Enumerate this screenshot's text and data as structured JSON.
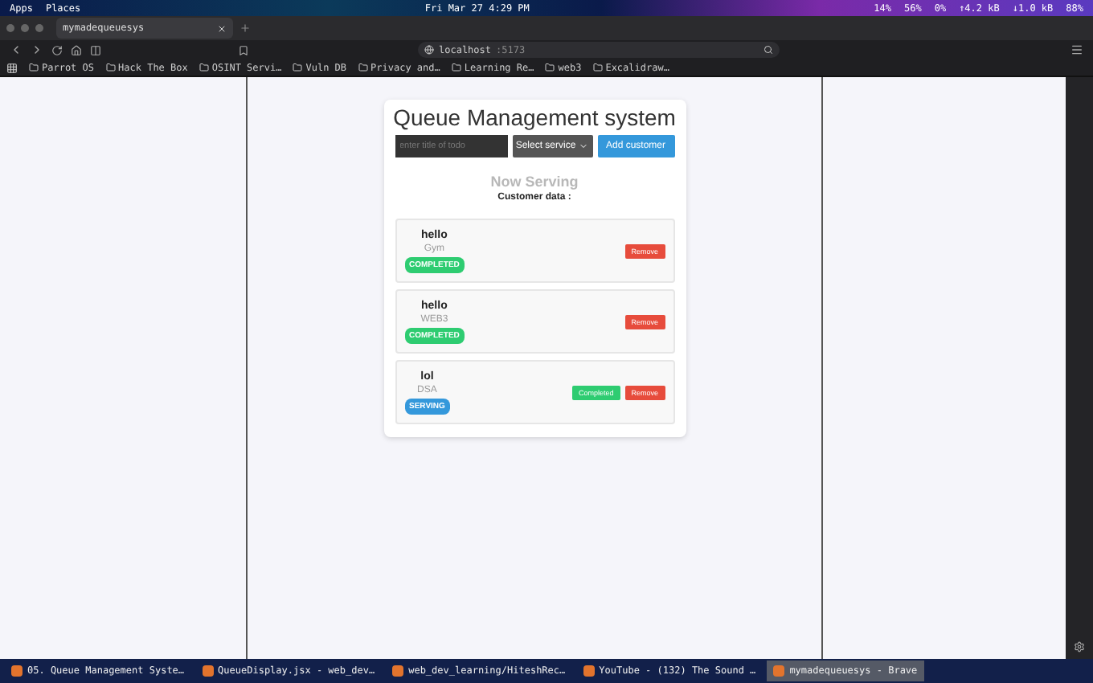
{
  "system_bar": {
    "menus": [
      "Apps",
      "Places"
    ],
    "clock": "Fri Mar 27  4:29 PM",
    "stats": [
      "14%",
      "56%",
      "0%",
      "↑4.2 kB",
      "↓1.0 kB",
      "88%"
    ]
  },
  "browser": {
    "tab_title": "mymadequeuesys",
    "address": "localhost",
    "port": ":5173",
    "bookmarks": [
      "Parrot OS",
      "Hack The Box",
      "OSINT Servi…",
      "Vuln DB",
      "Privacy and…",
      "Learning Re…",
      "web3",
      "Excalidraw…"
    ]
  },
  "app": {
    "title": "Queue Management system",
    "input": {
      "placeholder": "enter title of todo"
    },
    "select": "Select service",
    "add_button": "Add customer",
    "now_serving": "Now Serving",
    "section_label": "Customer data :",
    "customers": [
      {
        "name": "hello",
        "service": "Gym",
        "status": {
          "label": "COMPLETED",
          "kind": "completed"
        },
        "buttons": [
          {
            "label": "Remove",
            "kind": "remove"
          }
        ]
      },
      {
        "name": "hello",
        "service": "WEB3",
        "status": {
          "label": "COMPLETED",
          "kind": "completed"
        },
        "buttons": [
          {
            "label": "Remove",
            "kind": "remove"
          }
        ]
      },
      {
        "name": "lol",
        "service": "DSA",
        "status": {
          "label": "SERVING",
          "kind": "serving"
        },
        "buttons": [
          {
            "label": "Completed",
            "kind": "complete"
          },
          {
            "label": "Remove",
            "kind": "remove"
          }
        ]
      }
    ]
  },
  "taskbar": [
    {
      "label": "05. Queue Management Syste…",
      "selected": false
    },
    {
      "label": "QueueDisplay.jsx - web_dev…",
      "selected": false
    },
    {
      "label": "web_dev_learning/HiteshRec…",
      "selected": false
    },
    {
      "label": "YouTube - (132) The Sound …",
      "selected": false
    },
    {
      "label": "mymadequeuesys - Brave",
      "selected": true
    }
  ]
}
